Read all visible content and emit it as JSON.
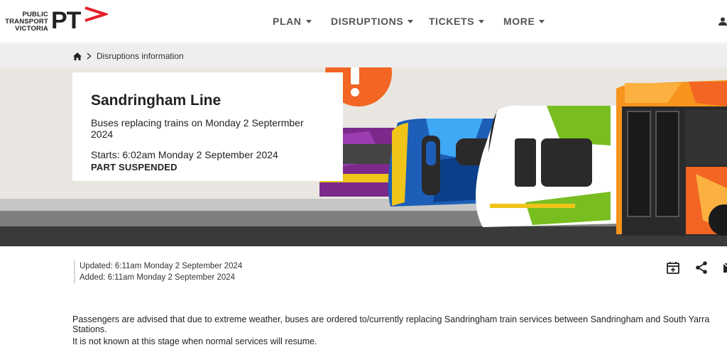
{
  "header": {
    "logo": {
      "line1": "PUBLIC",
      "line2": "TRANSPORT",
      "line3": "VICTORIA",
      "mark": "PT"
    },
    "nav": [
      {
        "label": "PLAN"
      },
      {
        "label": "DISRUPTIONS"
      },
      {
        "label": "TICKETS"
      },
      {
        "label": "MORE"
      }
    ],
    "user_icon": "user-icon"
  },
  "breadcrumb": {
    "home_icon": "home-icon",
    "current": "Disruptions information"
  },
  "hero": {
    "title": "Sandringham Line",
    "subtitle": "Buses replacing trains on Monday 2 Septermber 2024",
    "starts": "Starts: 6:02am Monday 2 September 2024",
    "status": "PART SUSPENDED",
    "colors": {
      "alert": "#f26522",
      "purple": "#7b2a8c",
      "blue": "#1d5fb8",
      "green": "#78be20",
      "orange": "#f7941d",
      "track": "#3a3a3a"
    }
  },
  "meta": {
    "updated": "Updated: 6:11am Monday 2 September 2024",
    "added": "Added: 6:11am Monday 2 September 2024"
  },
  "tools": [
    "calendar-add-icon",
    "share-icon",
    "email-icon"
  ],
  "content": {
    "p1": "Passengers are advised that due to extreme weather, buses are ordered to/currently replacing Sandringham train services between Sandringham and South Yarra Stations.",
    "p2": "It is not known at this stage when normal services will resume."
  }
}
